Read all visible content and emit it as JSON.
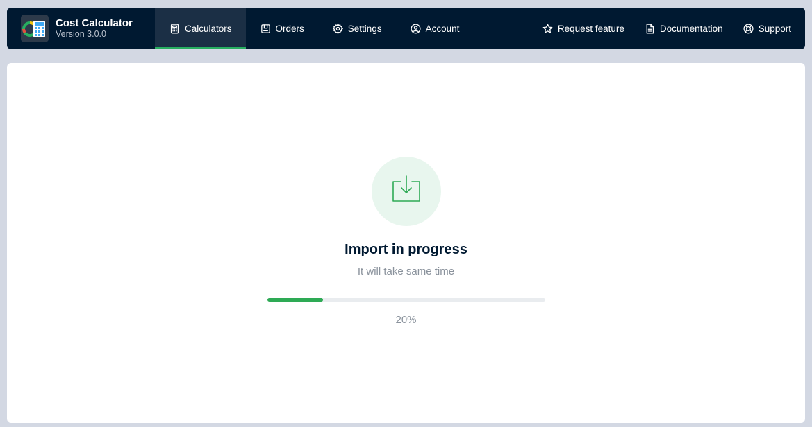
{
  "app": {
    "title": "Cost Calculator",
    "version": "Version 3.0.0",
    "logo_icon": "calculator-logo-icon"
  },
  "nav": {
    "left": [
      {
        "label": "Calculators",
        "icon": "calculator-icon",
        "active": true
      },
      {
        "label": "Orders",
        "icon": "orders-icon",
        "active": false
      },
      {
        "label": "Settings",
        "icon": "gear-icon",
        "active": false
      },
      {
        "label": "Account",
        "icon": "user-circle-icon",
        "active": false
      }
    ],
    "right": [
      {
        "label": "Request feature",
        "icon": "star-icon"
      },
      {
        "label": "Documentation",
        "icon": "document-icon"
      },
      {
        "label": "Support",
        "icon": "lifebuoy-icon"
      }
    ]
  },
  "import": {
    "icon": "import-download-icon",
    "title": "Import in progress",
    "subtitle": "It will take same time",
    "progress_percent": 20,
    "progress_label": "20%"
  },
  "colors": {
    "navbar_bg": "#001931",
    "accent_green": "#27ae60",
    "progress_fill": "#2eaa55",
    "page_bg": "#d3d8e3"
  }
}
